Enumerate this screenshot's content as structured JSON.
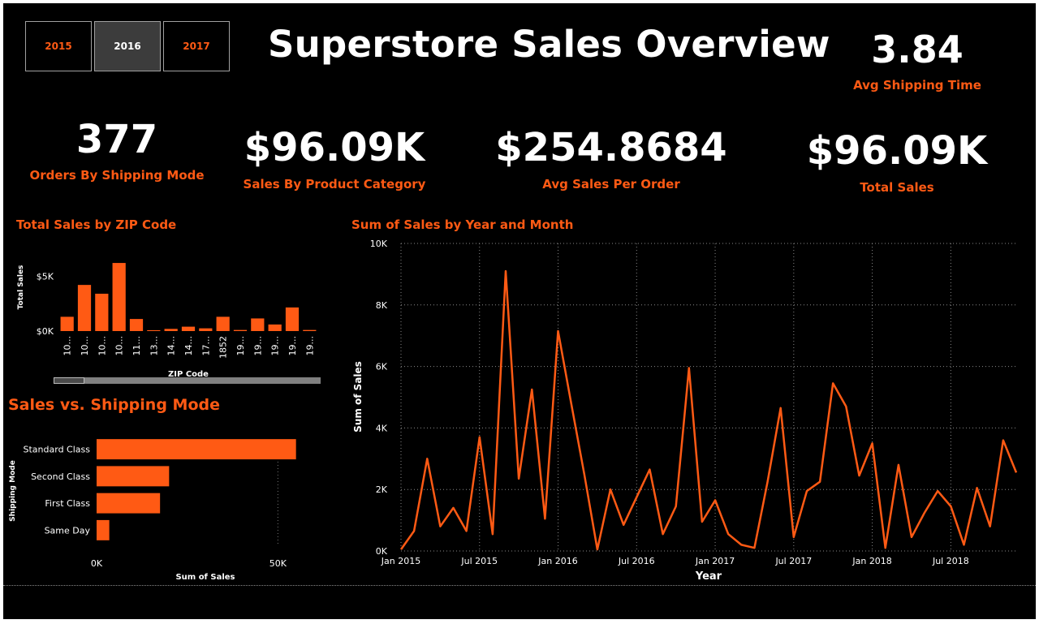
{
  "slicer": {
    "years": [
      "2015",
      "2016",
      "2017"
    ],
    "selected": "2016"
  },
  "header": {
    "title": "Superstore Sales Overview"
  },
  "kpis": {
    "avg_shipping": {
      "value": "3.84",
      "label": "Avg Shipping Time"
    },
    "orders": {
      "value": "377",
      "label": "Orders By Shipping Mode"
    },
    "sales_category": {
      "value": "$96.09K",
      "label": "Sales By Product Category"
    },
    "avg_sales": {
      "value": "$254.8684",
      "label": "Avg Sales Per Order"
    },
    "total_sales": {
      "value": "$96.09K",
      "label": "Total Sales"
    }
  },
  "colors": {
    "accent": "#ff5a14",
    "background": "#000000",
    "text": "#ffffff"
  },
  "chart_data": [
    {
      "id": "zip",
      "type": "bar",
      "title": "Total Sales by ZIP Code",
      "xlabel": "ZIP Code",
      "ylabel": "Total Sales",
      "ylim": [
        0,
        6500
      ],
      "yticks": [
        {
          "v": 0,
          "label": "$0K"
        },
        {
          "v": 5000,
          "label": "$5K"
        }
      ],
      "categories": [
        "10...",
        "10...",
        "10...",
        "10...",
        "11...",
        "13...",
        "14...",
        "14...",
        "17...",
        "1852",
        "19...",
        "19...",
        "19...",
        "19...",
        "19..."
      ],
      "values": [
        1300,
        4200,
        3400,
        6200,
        1100,
        80,
        200,
        400,
        250,
        1300,
        100,
        1150,
        600,
        2150,
        100
      ]
    },
    {
      "id": "ship",
      "type": "bar",
      "orientation": "horizontal",
      "title": "Sales vs. Shipping Mode",
      "xlabel": "Sum of Sales",
      "ylabel": "Shipping Mode",
      "xlim": [
        0,
        60000
      ],
      "xticks": [
        {
          "v": 0,
          "label": "0K"
        },
        {
          "v": 50000,
          "label": "50K"
        }
      ],
      "categories": [
        "Standard Class",
        "Second Class",
        "First Class",
        "Same Day"
      ],
      "values": [
        55000,
        20000,
        17500,
        3500
      ]
    },
    {
      "id": "monthly",
      "type": "line",
      "title": "Sum of Sales by Year and Month",
      "xlabel": "Year",
      "ylabel": "Sum of Sales",
      "ylim": [
        0,
        10000
      ],
      "yticks": [
        {
          "v": 0,
          "label": "0K"
        },
        {
          "v": 2000,
          "label": "2K"
        },
        {
          "v": 4000,
          "label": "4K"
        },
        {
          "v": 6000,
          "label": "6K"
        },
        {
          "v": 8000,
          "label": "8K"
        },
        {
          "v": 10000,
          "label": "10K"
        }
      ],
      "x": [
        "2015-01",
        "2015-02",
        "2015-03",
        "2015-04",
        "2015-05",
        "2015-06",
        "2015-07",
        "2015-08",
        "2015-09",
        "2015-10",
        "2015-11",
        "2015-12",
        "2016-01",
        "2016-02",
        "2016-03",
        "2016-04",
        "2016-05",
        "2016-06",
        "2016-07",
        "2016-08",
        "2016-09",
        "2016-10",
        "2016-11",
        "2016-12",
        "2017-01",
        "2017-02",
        "2017-03",
        "2017-04",
        "2017-05",
        "2017-06",
        "2017-07",
        "2017-08",
        "2017-09",
        "2017-10",
        "2017-11",
        "2017-12",
        "2018-01",
        "2018-02",
        "2018-03",
        "2018-04",
        "2018-05",
        "2018-06",
        "2018-07",
        "2018-08",
        "2018-09",
        "2018-10",
        "2018-11",
        "2018-12"
      ],
      "values": [
        50,
        650,
        3000,
        800,
        1400,
        650,
        3700,
        550,
        9100,
        2350,
        5250,
        1050,
        7150,
        4800,
        2500,
        50,
        2000,
        850,
        1750,
        2650,
        550,
        1450,
        5950,
        950,
        1650,
        550,
        200,
        100,
        2250,
        4650,
        450,
        1950,
        2250,
        5450,
        4700,
        2450,
        3500,
        100,
        2800,
        450,
        1250,
        1950,
        1450,
        200,
        2050,
        800,
        3600,
        2550
      ],
      "xticks": [
        {
          "x": "2015-01",
          "label": "Jan 2015"
        },
        {
          "x": "2015-07",
          "label": "Jul 2015"
        },
        {
          "x": "2016-01",
          "label": "Jan 2016"
        },
        {
          "x": "2016-07",
          "label": "Jul 2016"
        },
        {
          "x": "2017-01",
          "label": "Jan 2017"
        },
        {
          "x": "2017-07",
          "label": "Jul 2017"
        },
        {
          "x": "2018-01",
          "label": "Jan 2018"
        },
        {
          "x": "2018-07",
          "label": "Jul 2018"
        }
      ]
    }
  ]
}
